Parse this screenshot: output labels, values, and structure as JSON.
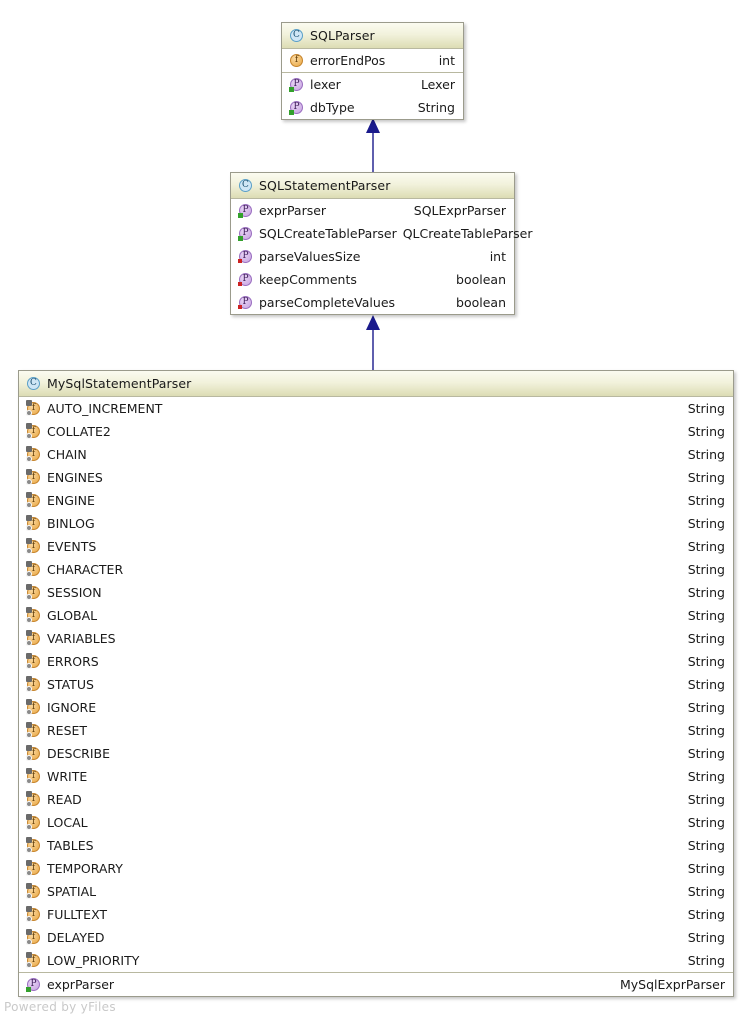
{
  "diagram": {
    "type": "uml-class-diagram",
    "watermark": "Powered by yFiles",
    "accent_color": "#1a1a8c",
    "header_gradient_top": "#fbfbf0",
    "header_gradient_bottom": "#dcdcb4",
    "border_color": "#9b9b8c"
  },
  "classes": [
    {
      "id": "sqlparser",
      "name": "SQLParser",
      "icon": "class-icon",
      "sections": [
        {
          "members": [
            {
              "name": "errorEndPos",
              "type": "int",
              "icon": "field-icon",
              "markers": []
            }
          ]
        },
        {
          "members": [
            {
              "name": "lexer",
              "type": "Lexer",
              "icon": "property-icon",
              "markers": [
                "green"
              ]
            },
            {
              "name": "dbType",
              "type": "String",
              "icon": "property-icon",
              "markers": [
                "green"
              ]
            }
          ]
        }
      ]
    },
    {
      "id": "sqlstatementparser",
      "name": "SQLStatementParser",
      "icon": "class-icon",
      "sections": [
        {
          "members": [
            {
              "name": "exprParser",
              "type": "SQLExprParser",
              "icon": "property-icon",
              "markers": [
                "green"
              ]
            },
            {
              "name": "SQLCreateTableParser",
              "type": "QLCreateTableParser",
              "icon": "property-icon",
              "markers": [
                "green"
              ]
            },
            {
              "name": "parseValuesSize",
              "type": "int",
              "icon": "property-icon",
              "markers": [
                "red"
              ]
            },
            {
              "name": "keepComments",
              "type": "boolean",
              "icon": "property-icon",
              "markers": [
                "red"
              ]
            },
            {
              "name": "parseCompleteValues",
              "type": "boolean",
              "icon": "property-icon",
              "markers": [
                "red"
              ]
            }
          ]
        }
      ]
    },
    {
      "id": "mysqlstatementparser",
      "name": "MySqlStatementParser",
      "icon": "class-icon",
      "sections": [
        {
          "members": [
            {
              "name": "AUTO_INCREMENT",
              "type": "String",
              "icon": "static-final-field-icon",
              "markers": [
                "gear"
              ]
            },
            {
              "name": "COLLATE2",
              "type": "String",
              "icon": "static-final-field-icon",
              "markers": [
                "gear"
              ]
            },
            {
              "name": "CHAIN",
              "type": "String",
              "icon": "static-final-field-icon",
              "markers": [
                "gear"
              ]
            },
            {
              "name": "ENGINES",
              "type": "String",
              "icon": "static-final-field-icon",
              "markers": [
                "gear"
              ]
            },
            {
              "name": "ENGINE",
              "type": "String",
              "icon": "static-final-field-icon",
              "markers": [
                "gear"
              ]
            },
            {
              "name": "BINLOG",
              "type": "String",
              "icon": "static-final-field-icon",
              "markers": [
                "gear"
              ]
            },
            {
              "name": "EVENTS",
              "type": "String",
              "icon": "static-final-field-icon",
              "markers": [
                "gear"
              ]
            },
            {
              "name": "CHARACTER",
              "type": "String",
              "icon": "static-final-field-icon",
              "markers": [
                "gear"
              ]
            },
            {
              "name": "SESSION",
              "type": "String",
              "icon": "static-final-field-icon",
              "markers": [
                "gear"
              ]
            },
            {
              "name": "GLOBAL",
              "type": "String",
              "icon": "static-final-field-icon",
              "markers": [
                "gear"
              ]
            },
            {
              "name": "VARIABLES",
              "type": "String",
              "icon": "static-final-field-icon",
              "markers": [
                "gear"
              ]
            },
            {
              "name": "ERRORS",
              "type": "String",
              "icon": "static-final-field-icon",
              "markers": [
                "gear"
              ]
            },
            {
              "name": "STATUS",
              "type": "String",
              "icon": "static-final-field-icon",
              "markers": [
                "gear"
              ]
            },
            {
              "name": "IGNORE",
              "type": "String",
              "icon": "static-final-field-icon",
              "markers": [
                "gear"
              ]
            },
            {
              "name": "RESET",
              "type": "String",
              "icon": "static-final-field-icon",
              "markers": [
                "gear"
              ]
            },
            {
              "name": "DESCRIBE",
              "type": "String",
              "icon": "static-final-field-icon",
              "markers": [
                "gear"
              ]
            },
            {
              "name": "WRITE",
              "type": "String",
              "icon": "static-final-field-icon",
              "markers": [
                "gear"
              ]
            },
            {
              "name": "READ",
              "type": "String",
              "icon": "static-final-field-icon",
              "markers": [
                "gear"
              ]
            },
            {
              "name": "LOCAL",
              "type": "String",
              "icon": "static-final-field-icon",
              "markers": [
                "gear"
              ]
            },
            {
              "name": "TABLES",
              "type": "String",
              "icon": "static-final-field-icon",
              "markers": [
                "gear"
              ]
            },
            {
              "name": "TEMPORARY",
              "type": "String",
              "icon": "static-final-field-icon",
              "markers": [
                "gear"
              ]
            },
            {
              "name": "SPATIAL",
              "type": "String",
              "icon": "static-final-field-icon",
              "markers": [
                "gear"
              ]
            },
            {
              "name": "FULLTEXT",
              "type": "String",
              "icon": "static-final-field-icon",
              "markers": [
                "gear"
              ]
            },
            {
              "name": "DELAYED",
              "type": "String",
              "icon": "static-final-field-icon",
              "markers": [
                "gear"
              ]
            },
            {
              "name": "LOW_PRIORITY",
              "type": "String",
              "icon": "static-final-field-icon",
              "markers": [
                "gear"
              ]
            }
          ]
        },
        {
          "members": [
            {
              "name": "exprParser",
              "type": "MySqlExprParser",
              "icon": "property-icon",
              "markers": [
                "green"
              ]
            }
          ]
        }
      ]
    }
  ],
  "edges": [
    {
      "id": "edge-mysql-to-sqlstatement",
      "kind": "generalization",
      "from": "MySqlStatementParser",
      "to": "SQLStatementParser"
    },
    {
      "id": "edge-sqlstatement-to-sqlparser",
      "kind": "generalization",
      "from": "SQLStatementParser",
      "to": "SQLParser"
    }
  ]
}
